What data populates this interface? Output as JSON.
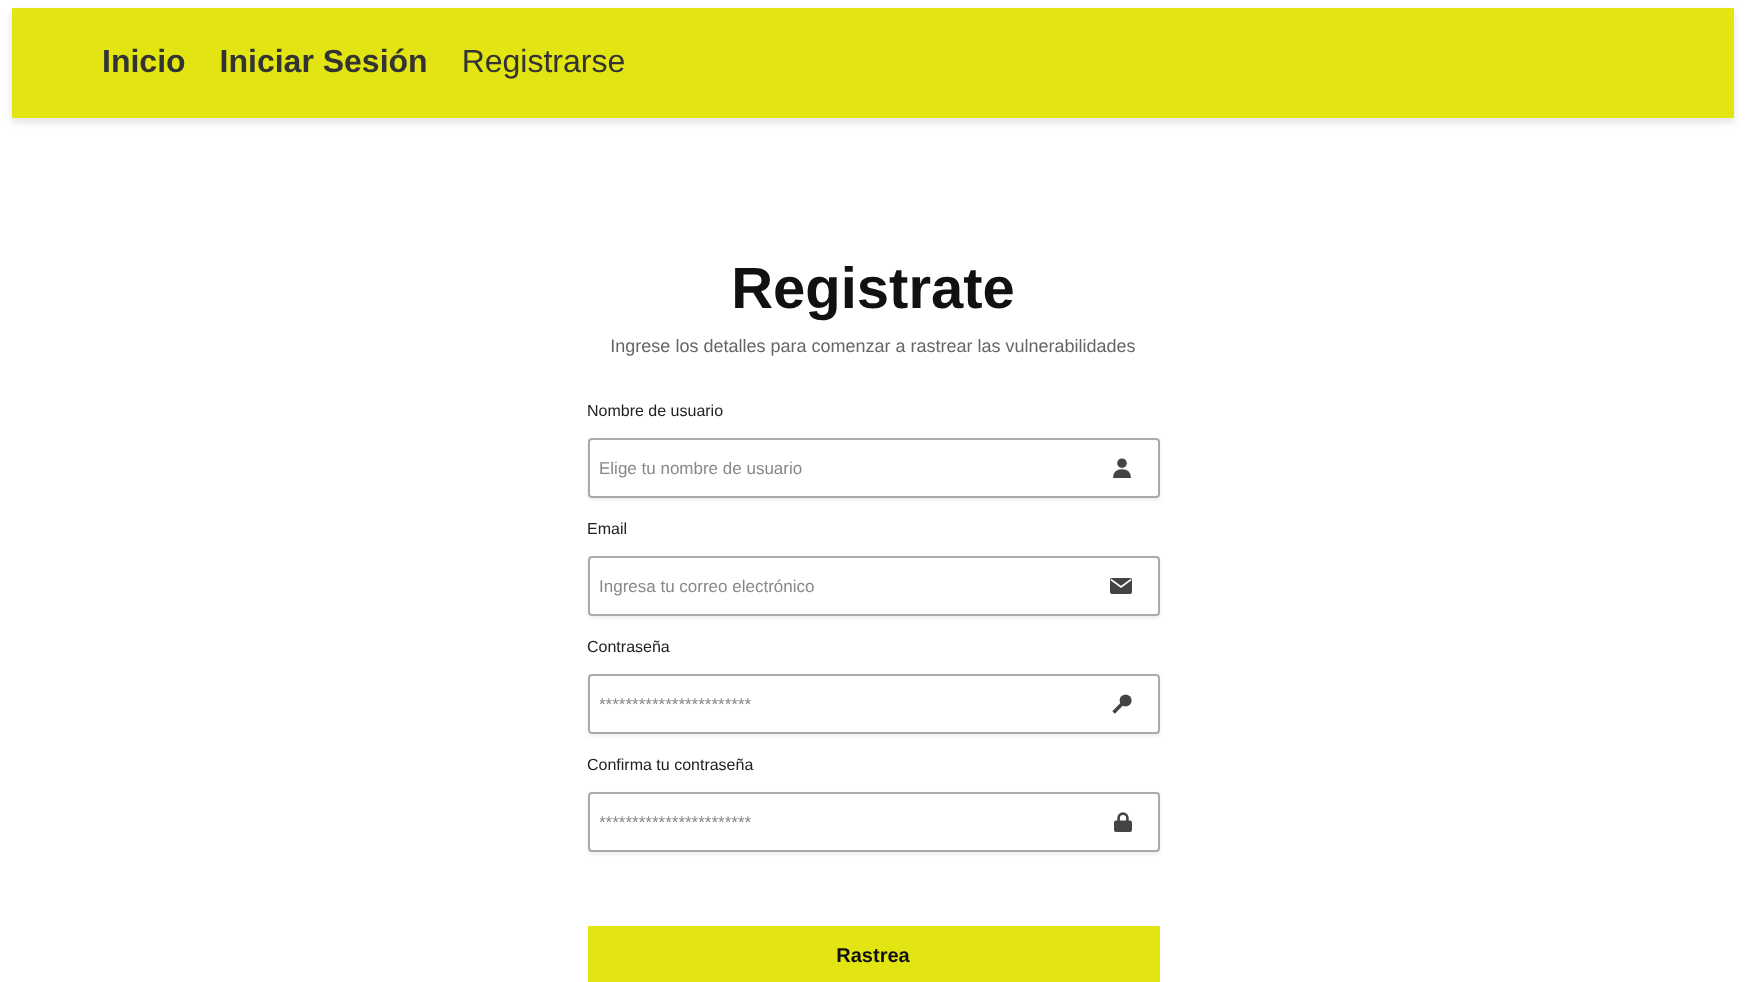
{
  "nav": [
    {
      "label": "Inicio",
      "selected": false
    },
    {
      "label": "Iniciar Sesión",
      "selected": false
    },
    {
      "label": "Registrarse",
      "selected": true
    }
  ],
  "title": "Registrate",
  "subtitle": "Ingrese los detalles para comenzar a rastrear las vulnerabilidades",
  "fields": [
    {
      "label": "Nombre de usuario",
      "placeholder": "Elige tu nombre de usuario",
      "kind": "user"
    },
    {
      "label": "Email",
      "placeholder": "Ingresa tu correo electrónico",
      "kind": "email"
    },
    {
      "label": "Contraseña",
      "placeholder": "***********************",
      "kind": "key"
    },
    {
      "label": "Confirma tu contraseña",
      "placeholder": "***********************",
      "kind": "lock"
    }
  ],
  "submit": "Rastrea"
}
